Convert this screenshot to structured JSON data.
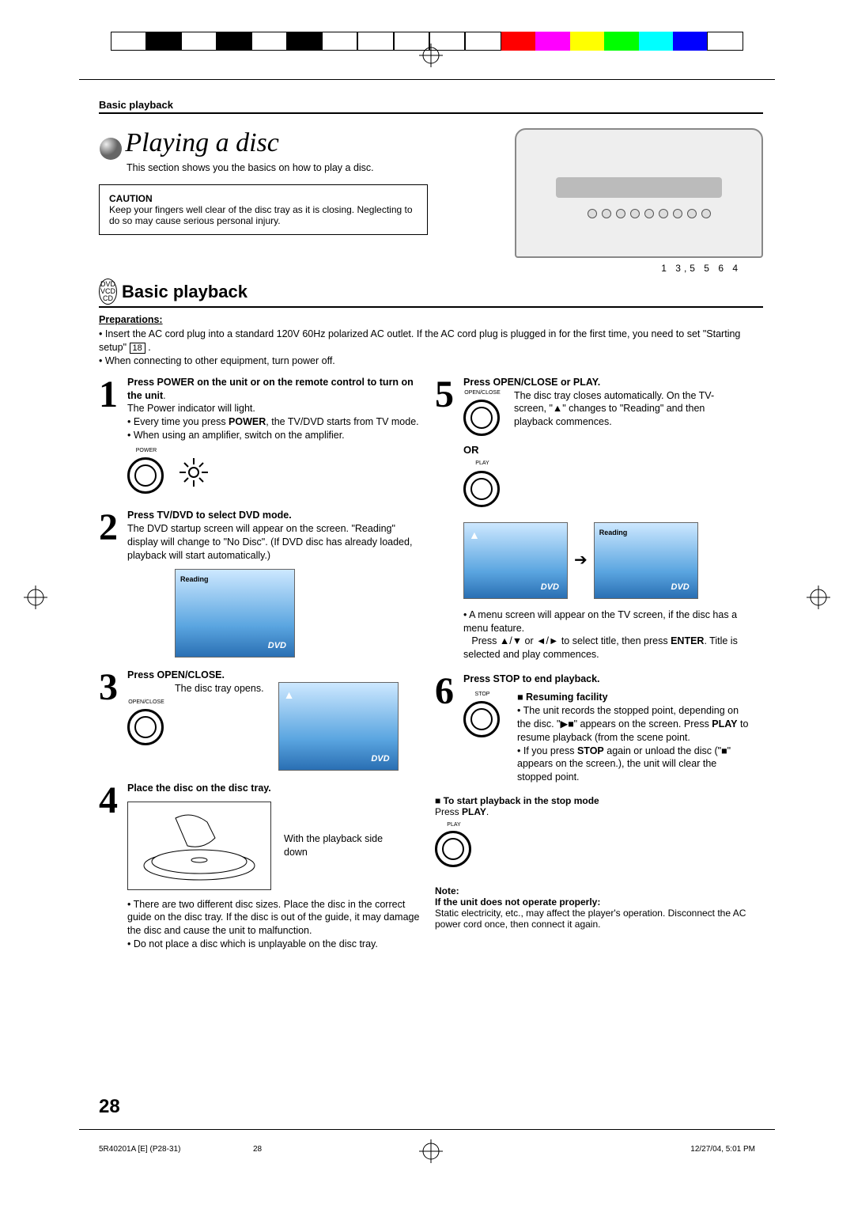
{
  "header": {
    "section": "Basic playback"
  },
  "title": "Playing a disc",
  "intro": "This section shows you the basics on how to play a disc.",
  "caution": {
    "head": "CAUTION",
    "body": "Keep your fingers well clear of the disc tray as it is closing. Neglecting to do so may cause serious personal injury."
  },
  "icons_stack": "DVD\nVCD\nCD",
  "sub_head": "Basic playback",
  "preparations_head": "Preparations:",
  "prep1a": "Insert the AC cord plug into a standard 120V 60Hz polarized AC outlet. If the AC cord plug is plugged in for the first time, you need to set \"Starting setup\" ",
  "prep1b": "18",
  "prep1c": " .",
  "prep2": "When connecting to other equipment, turn power off.",
  "device_labels": "1  3,5       5  6    4",
  "steps": {
    "s1": {
      "num": "1",
      "title": "Press POWER on the unit or on the remote control to turn on the unit",
      "line1": "The Power indicator will light.",
      "b1a": "Every time you press ",
      "b1b": "POWER",
      "b1c": ", the TV/DVD starts from TV mode.",
      "b2": "When using an amplifier, switch on the amplifier.",
      "btn_label": "POWER"
    },
    "s2": {
      "num": "2",
      "title": "Press TV/DVD to select DVD mode.",
      "body": "The DVD startup screen will appear on the screen. \"Reading\" display will change to \"No Disc\". (If DVD disc has already loaded, playback will start automatically.)",
      "reading": "Reading",
      "dvd": "DVD"
    },
    "s3": {
      "num": "3",
      "title": "Press OPEN/CLOSE.",
      "body": "The disc tray opens.",
      "btn_label": "OPEN/CLOSE",
      "eject": "▲",
      "dvd": "DVD"
    },
    "s4": {
      "num": "4",
      "title": "Place the disc on the disc tray.",
      "side": "With the playback side down",
      "b1": "There are two different disc sizes. Place the disc in the correct guide on the disc tray. If the disc is out of the guide, it may damage the disc and cause the unit to malfunction.",
      "b2": "Do not place a disc which is unplayable on the disc tray."
    },
    "s5": {
      "num": "5",
      "title": "Press OPEN/CLOSE or PLAY.",
      "btn1": "OPEN/CLOSE",
      "or": "OR",
      "btn2": "PLAY",
      "body": "The disc tray closes automatically. On the TV-screen, \"▲\" changes to \"Reading\" and then playback commences.",
      "eject": "▲",
      "reading": "Reading",
      "dvd": "DVD",
      "b1": "A menu screen will appear on the TV screen, if the disc has a menu feature.",
      "b2a": "Press ▲/▼ or ◄/► to select title, then press ",
      "b2b": "ENTER",
      "b2c": ". Title is selected and play commences."
    },
    "s6": {
      "num": "6",
      "title": "Press STOP to end playback.",
      "btn_label": "STOP",
      "resume_head": "■ Resuming facility",
      "r1a": "The unit records the stopped point, depending on the disc. \"▶■\" appears on the screen. Press ",
      "r1b": "PLAY",
      "r1c": " to resume playback (from the scene point.",
      "r2a": "If you press ",
      "r2b": "STOP",
      "r2c": " again or unload the disc (\"■\" appears on the screen.), the unit will clear the stopped point."
    }
  },
  "restart": {
    "head": "■ To start playback in the stop mode",
    "body": "Press ",
    "play": "PLAY",
    "dot": ".",
    "btn_label": "PLAY"
  },
  "note": {
    "head": "Note:",
    "sub": "If the unit does not operate properly:",
    "body": "Static electricity, etc., may affect the player's operation. Disconnect the AC power cord once, then connect it again."
  },
  "page_num": "28",
  "footer": {
    "left": "5R40201A [E] (P28-31)",
    "mid": "28",
    "right": "12/27/04, 5:01 PM"
  }
}
